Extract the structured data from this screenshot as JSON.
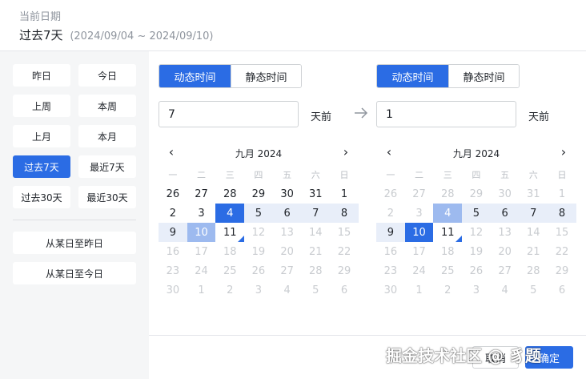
{
  "header": {
    "label": "当前日期",
    "value": "过去7天",
    "range": "(2024/09/04 ~ 2024/09/10)"
  },
  "shortcuts": [
    {
      "label": "昨日",
      "selected": false
    },
    {
      "label": "今日",
      "selected": false
    },
    {
      "label": "上周",
      "selected": false
    },
    {
      "label": "本周",
      "selected": false
    },
    {
      "label": "上月",
      "selected": false
    },
    {
      "label": "本月",
      "selected": false
    },
    {
      "label": "过去7天",
      "selected": true
    },
    {
      "label": "最近7天",
      "selected": false
    },
    {
      "label": "过去30天",
      "selected": false
    },
    {
      "label": "最近30天",
      "selected": false
    }
  ],
  "shortcuts_wide": [
    {
      "label": "从某日至昨日"
    },
    {
      "label": "从某日至今日"
    }
  ],
  "start": {
    "mode_dynamic": "动态时间",
    "mode_static": "静态时间",
    "active_mode": "dynamic",
    "value": "7",
    "unit": "天前"
  },
  "end": {
    "mode_dynamic": "动态时间",
    "mode_static": "静态时间",
    "active_mode": "dynamic",
    "value": "1",
    "unit": "天前"
  },
  "calendar_left": {
    "month": "九月 2024",
    "prev": "‹",
    "next": "›",
    "weekdays": [
      "一",
      "二",
      "三",
      "四",
      "五",
      "六",
      "日"
    ],
    "days": [
      {
        "d": "26",
        "s": "cur"
      },
      {
        "d": "27",
        "s": "cur"
      },
      {
        "d": "28",
        "s": "cur"
      },
      {
        "d": "29",
        "s": "cur"
      },
      {
        "d": "30",
        "s": "cur"
      },
      {
        "d": "31",
        "s": "cur"
      },
      {
        "d": "1",
        "s": "cur"
      },
      {
        "d": "2",
        "s": "cur"
      },
      {
        "d": "3",
        "s": "cur"
      },
      {
        "d": "4",
        "s": "start"
      },
      {
        "d": "5",
        "s": "range"
      },
      {
        "d": "6",
        "s": "range"
      },
      {
        "d": "7",
        "s": "range"
      },
      {
        "d": "8",
        "s": "range"
      },
      {
        "d": "9",
        "s": "range"
      },
      {
        "d": "10",
        "s": "pal"
      },
      {
        "d": "11",
        "s": "today"
      },
      {
        "d": "12",
        "s": "disabled"
      },
      {
        "d": "13",
        "s": "disabled"
      },
      {
        "d": "14",
        "s": "disabled"
      },
      {
        "d": "15",
        "s": "disabled"
      },
      {
        "d": "16",
        "s": "disabled"
      },
      {
        "d": "17",
        "s": "disabled"
      },
      {
        "d": "18",
        "s": "disabled"
      },
      {
        "d": "19",
        "s": "disabled"
      },
      {
        "d": "20",
        "s": "disabled"
      },
      {
        "d": "21",
        "s": "disabled"
      },
      {
        "d": "22",
        "s": "disabled"
      },
      {
        "d": "23",
        "s": "disabled"
      },
      {
        "d": "24",
        "s": "disabled"
      },
      {
        "d": "25",
        "s": "disabled"
      },
      {
        "d": "26",
        "s": "disabled"
      },
      {
        "d": "27",
        "s": "disabled"
      },
      {
        "d": "28",
        "s": "disabled"
      },
      {
        "d": "29",
        "s": "disabled"
      },
      {
        "d": "30",
        "s": "disabled"
      },
      {
        "d": "1",
        "s": "disabled"
      },
      {
        "d": "2",
        "s": "disabled"
      },
      {
        "d": "3",
        "s": "disabled"
      },
      {
        "d": "4",
        "s": "disabled"
      },
      {
        "d": "5",
        "s": "disabled"
      },
      {
        "d": "6",
        "s": "disabled"
      }
    ]
  },
  "calendar_right": {
    "month": "九月 2024",
    "prev": "‹",
    "next": "›",
    "weekdays": [
      "一",
      "二",
      "三",
      "四",
      "五",
      "六",
      "日"
    ],
    "days": [
      {
        "d": "26",
        "s": "disabled"
      },
      {
        "d": "27",
        "s": "disabled"
      },
      {
        "d": "28",
        "s": "disabled"
      },
      {
        "d": "29",
        "s": "disabled"
      },
      {
        "d": "30",
        "s": "disabled"
      },
      {
        "d": "31",
        "s": "disabled"
      },
      {
        "d": "1",
        "s": "disabled"
      },
      {
        "d": "2",
        "s": "disabled"
      },
      {
        "d": "3",
        "s": "disabled"
      },
      {
        "d": "4",
        "s": "pal"
      },
      {
        "d": "5",
        "s": "range"
      },
      {
        "d": "6",
        "s": "range"
      },
      {
        "d": "7",
        "s": "range"
      },
      {
        "d": "8",
        "s": "range"
      },
      {
        "d": "9",
        "s": "range"
      },
      {
        "d": "10",
        "s": "selend"
      },
      {
        "d": "11",
        "s": "today"
      },
      {
        "d": "12",
        "s": "disabled"
      },
      {
        "d": "13",
        "s": "disabled"
      },
      {
        "d": "14",
        "s": "disabled"
      },
      {
        "d": "15",
        "s": "disabled"
      },
      {
        "d": "16",
        "s": "disabled"
      },
      {
        "d": "17",
        "s": "disabled"
      },
      {
        "d": "18",
        "s": "disabled"
      },
      {
        "d": "19",
        "s": "disabled"
      },
      {
        "d": "20",
        "s": "disabled"
      },
      {
        "d": "21",
        "s": "disabled"
      },
      {
        "d": "22",
        "s": "disabled"
      },
      {
        "d": "23",
        "s": "disabled"
      },
      {
        "d": "24",
        "s": "disabled"
      },
      {
        "d": "25",
        "s": "disabled"
      },
      {
        "d": "26",
        "s": "disabled"
      },
      {
        "d": "27",
        "s": "disabled"
      },
      {
        "d": "28",
        "s": "disabled"
      },
      {
        "d": "29",
        "s": "disabled"
      },
      {
        "d": "30",
        "s": "disabled"
      },
      {
        "d": "1",
        "s": "disabled"
      },
      {
        "d": "2",
        "s": "disabled"
      },
      {
        "d": "3",
        "s": "disabled"
      },
      {
        "d": "4",
        "s": "disabled"
      },
      {
        "d": "5",
        "s": "disabled"
      },
      {
        "d": "6",
        "s": "disabled"
      }
    ]
  },
  "footer": {
    "cancel_label": "取消",
    "ok_label": "确定"
  },
  "watermark": "掘金技术社区 @ 豸题",
  "colors": {
    "accent": "#2b6ce4",
    "range_bg": "#e8eef9",
    "pale_selected": "#9dbaef"
  }
}
